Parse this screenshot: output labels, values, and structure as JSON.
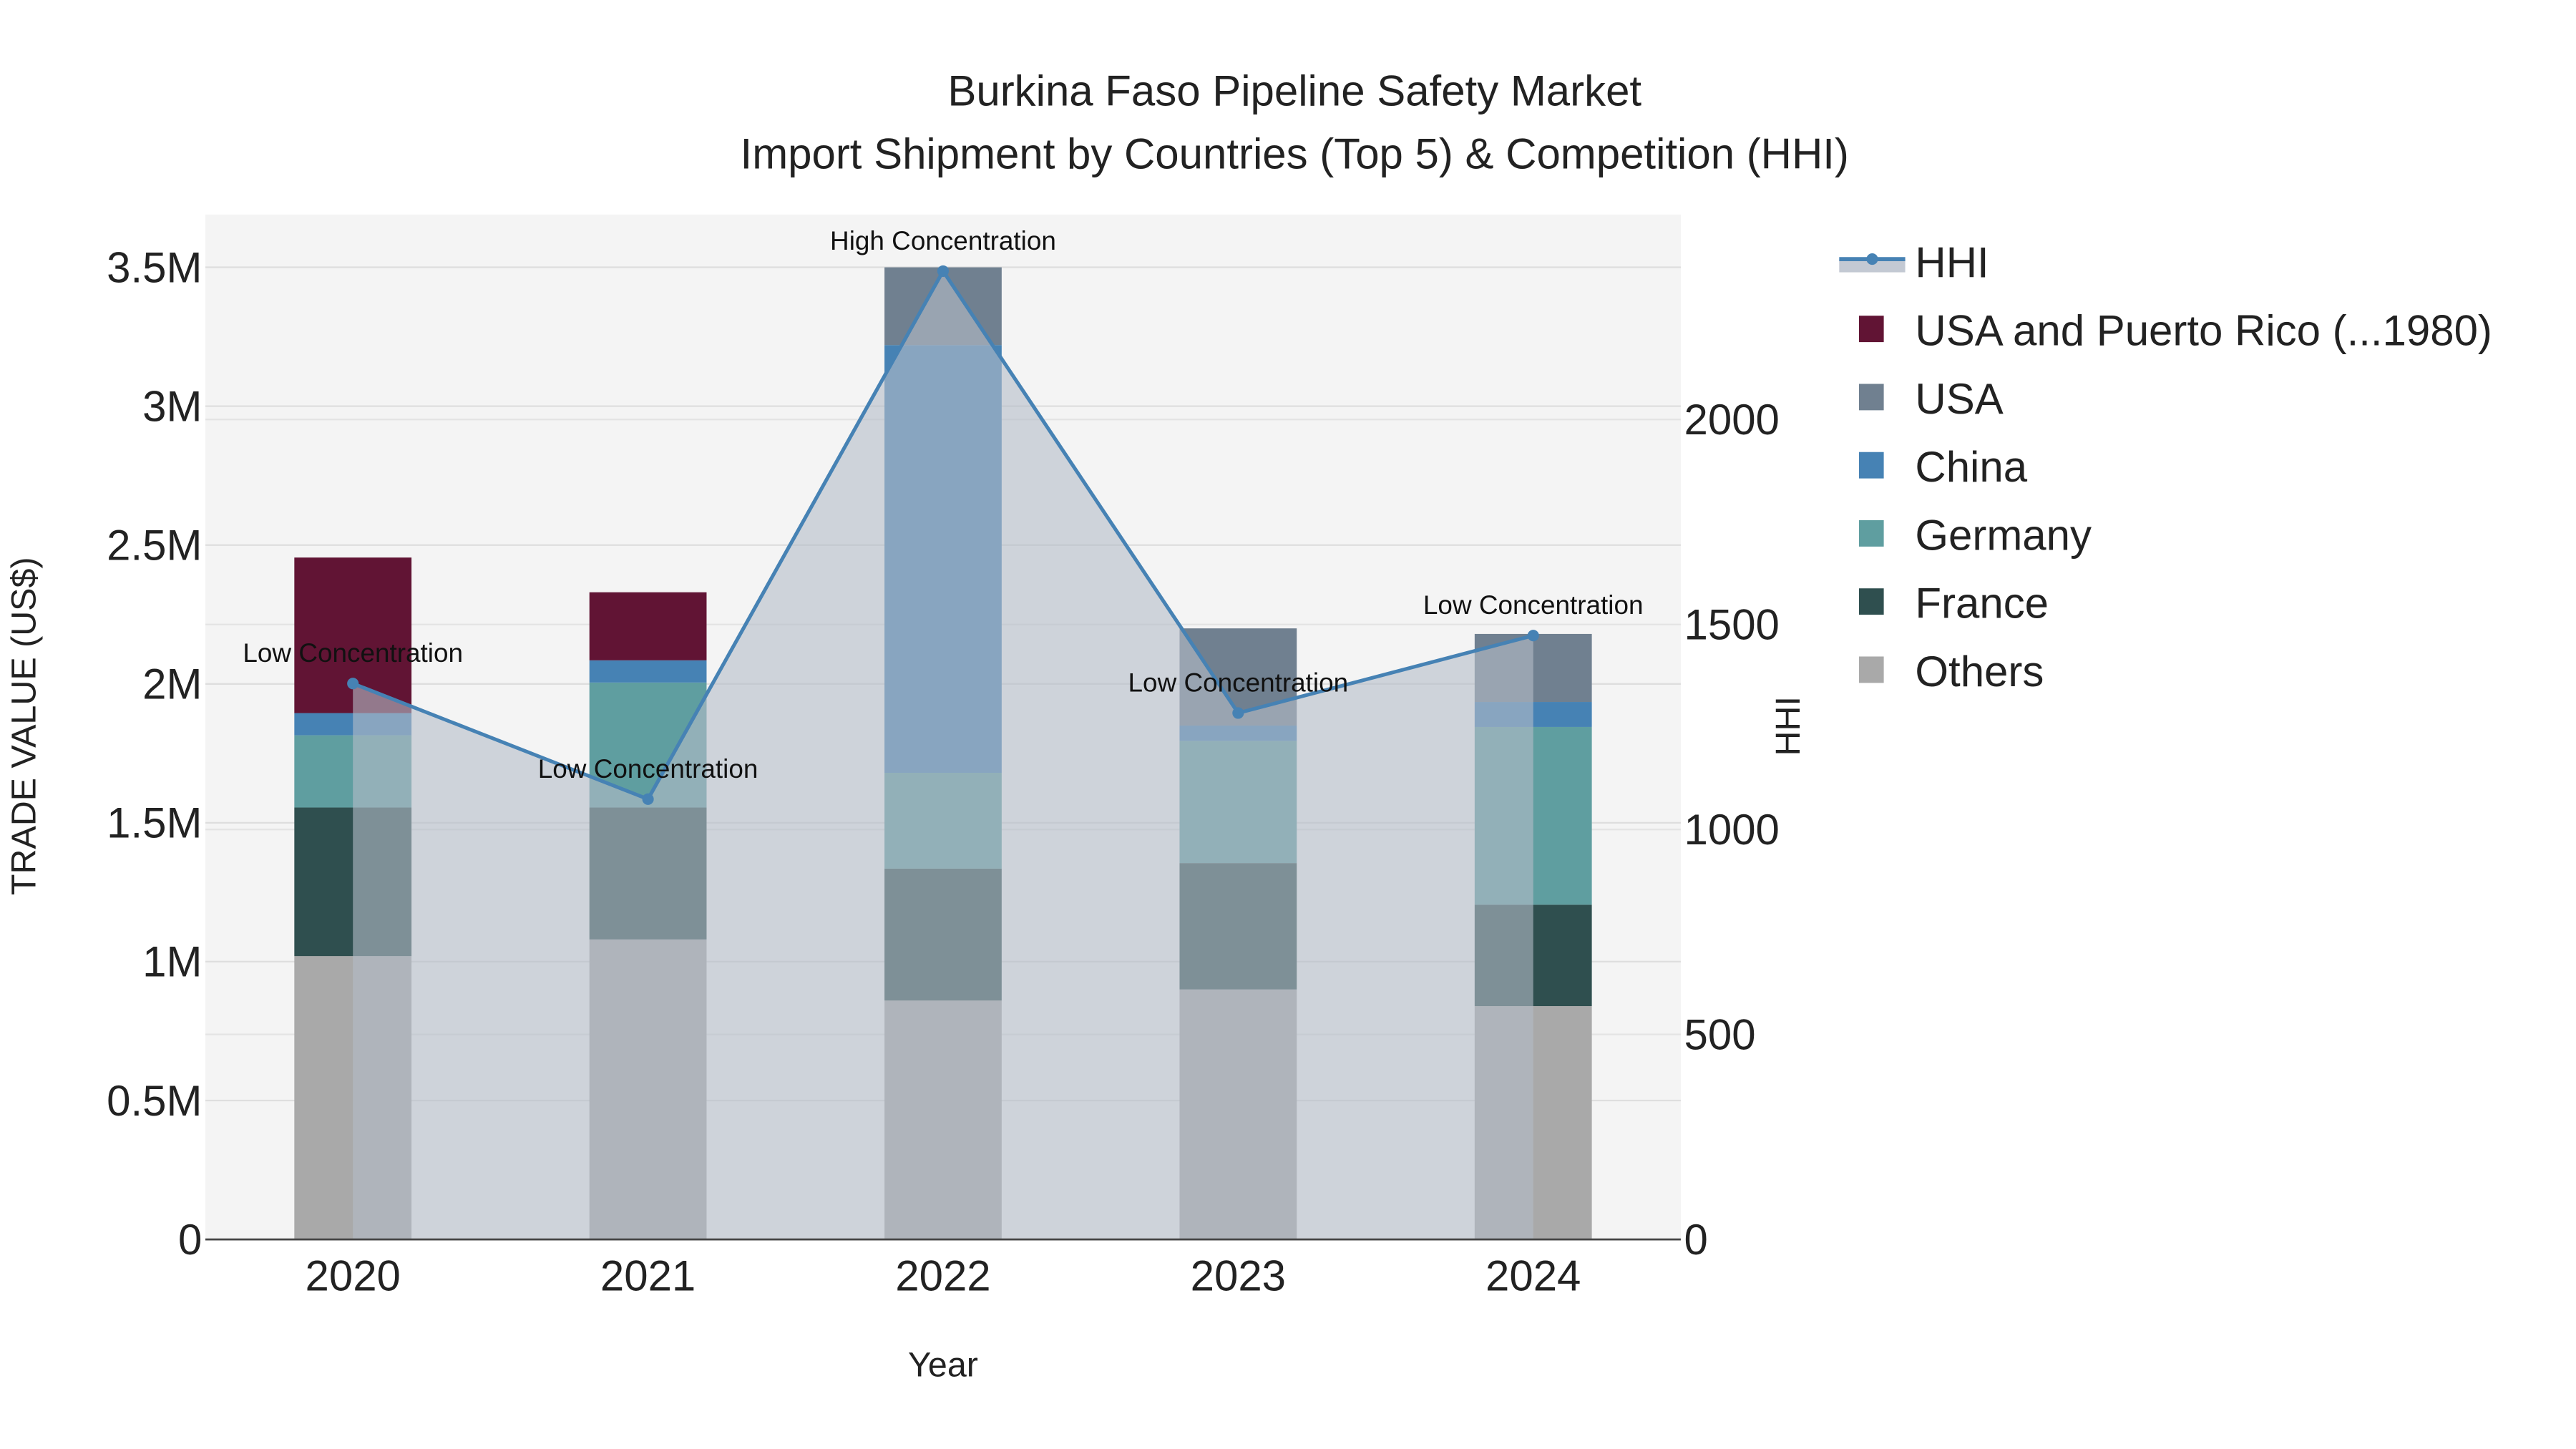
{
  "chart_data": {
    "type": "bar",
    "stacked": true,
    "title": "Burkina Faso Pipeline Safety Market",
    "subtitle": "Import Shipment by Countries (Top 5) & Competition (HHI)",
    "xlabel": "Year",
    "ylabel": "TRADE VALUE (US$)",
    "y2label": "HHI",
    "categories": [
      "2020",
      "2021",
      "2022",
      "2023",
      "2024"
    ],
    "ylim": [
      0,
      3690000
    ],
    "y2lim": [
      0,
      2500
    ],
    "yticks": [
      {
        "v": 0,
        "label": "0"
      },
      {
        "v": 500000,
        "label": "0.5M"
      },
      {
        "v": 1000000,
        "label": "1M"
      },
      {
        "v": 1500000,
        "label": "1.5M"
      },
      {
        "v": 2000000,
        "label": "2M"
      },
      {
        "v": 2500000,
        "label": "2.5M"
      },
      {
        "v": 3000000,
        "label": "3M"
      },
      {
        "v": 3500000,
        "label": "3.5M"
      }
    ],
    "y2ticks": [
      {
        "v": 0,
        "label": "0"
      },
      {
        "v": 500,
        "label": "500"
      },
      {
        "v": 1000,
        "label": "1000"
      },
      {
        "v": 1500,
        "label": "1500"
      },
      {
        "v": 2000,
        "label": "2000"
      }
    ],
    "grid": true,
    "legend_placement": "right",
    "series": [
      {
        "name": "Others",
        "color": "#A9A9A9",
        "values": [
          1020000,
          1080000,
          860000,
          900000,
          840000
        ]
      },
      {
        "name": "France",
        "color": "#2F4F4F",
        "values": [
          535000,
          475000,
          475000,
          455000,
          365000
        ]
      },
      {
        "name": "Germany",
        "color": "#5F9EA0",
        "values": [
          260000,
          450000,
          345000,
          440000,
          640000
        ]
      },
      {
        "name": "China",
        "color": "#4682B4",
        "values": [
          80000,
          80000,
          1540000,
          55000,
          90000
        ]
      },
      {
        "name": "USA",
        "color": "#708090",
        "values": [
          0,
          0,
          280000,
          350000,
          245000
        ]
      },
      {
        "name": "USA and Puerto Rico (...1980)",
        "color": "#611434",
        "values": [
          560000,
          245000,
          0,
          0,
          0
        ]
      }
    ],
    "hhi": {
      "name": "HHI",
      "color": "#4682B4",
      "values": [
        1356,
        1074,
        2362,
        1284,
        1473
      ],
      "annotations": [
        "Low Concentration",
        "Low Concentration",
        "High Concentration",
        "Low Concentration",
        "Low Concentration"
      ]
    },
    "legend_order": [
      "HHI",
      "USA and Puerto Rico (...1980)",
      "USA",
      "China",
      "Germany",
      "France",
      "Others"
    ]
  }
}
